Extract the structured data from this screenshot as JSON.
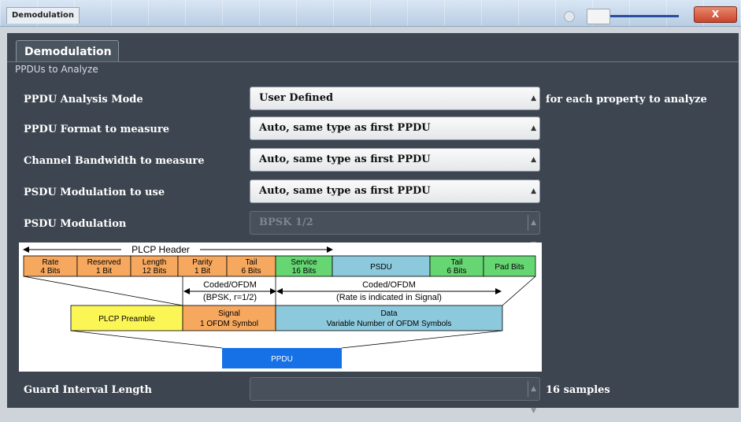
{
  "window": {
    "title": "Demodulation",
    "close_label": "X"
  },
  "tab": {
    "label": "Demodulation"
  },
  "section": {
    "title": "PPDUs to Analyze"
  },
  "fields": [
    {
      "label": "PPDU Analysis Mode",
      "value": "User Defined",
      "suffix": "for each property to analyze",
      "enabled": true
    },
    {
      "label": "PPDU Format to measure",
      "value": "Auto, same type as first PPDU",
      "enabled": true
    },
    {
      "label": "Channel Bandwidth to measure",
      "value": "Auto, same type as first PPDU",
      "enabled": true
    },
    {
      "label": "PSDU Modulation to use",
      "value": "Auto, same type as first PPDU",
      "enabled": true
    },
    {
      "label": "PSDU Modulation",
      "value": "BPSK 1/2",
      "enabled": false
    }
  ],
  "guard": {
    "label": "Guard Interval Length",
    "value": "",
    "suffix": "16 samples",
    "enabled": false
  },
  "diagram": {
    "plcp_header": "PLCP Header",
    "header_cells": [
      {
        "name": "rate",
        "l1": "Rate",
        "l2": "4 Bits",
        "color": "#f6a85f"
      },
      {
        "name": "reserved",
        "l1": "Reserved",
        "l2": "1 Bit",
        "color": "#f6a85f"
      },
      {
        "name": "length",
        "l1": "Length",
        "l2": "12 Bits",
        "color": "#f6a85f"
      },
      {
        "name": "parity",
        "l1": "Parity",
        "l2": "1 Bit",
        "color": "#f6a85f"
      },
      {
        "name": "tail",
        "l1": "Tail",
        "l2": "6 Bits",
        "color": "#f6a85f"
      },
      {
        "name": "service",
        "l1": "Service",
        "l2": "16 Bits",
        "color": "#66d673"
      },
      {
        "name": "psdu",
        "l1": "PSDU",
        "l2": "",
        "color": "#8dc9dc"
      },
      {
        "name": "tail2",
        "l1": "Tail",
        "l2": "6 Bits",
        "color": "#66d673"
      },
      {
        "name": "pad",
        "l1": "Pad Bits",
        "l2": "",
        "color": "#66d673"
      }
    ],
    "coded_left_1": "Coded/OFDM",
    "coded_left_2": "(BPSK, r=1/2)",
    "coded_right_1": "Coded/OFDM",
    "coded_right_2": "(Rate is indicated in Signal)",
    "preamble": "PLCP Preamble",
    "signal_1": "Signal",
    "signal_2": "1 OFDM Symbol",
    "data_1": "Data",
    "data_2": "Variable Number of OFDM Symbols",
    "ppdu": "PPDU",
    "colors": {
      "preamble": "#fbf556",
      "signal": "#f6a85f",
      "data": "#8dc9dc",
      "ppdu": "#1670e6"
    }
  }
}
